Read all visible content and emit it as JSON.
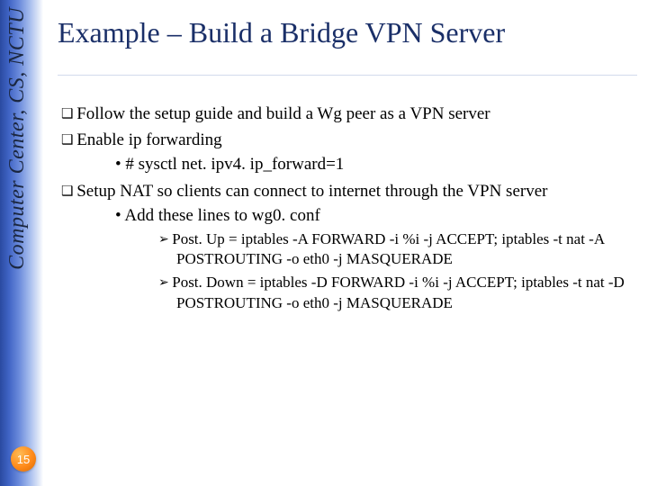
{
  "sidebar": {
    "org_text": "Computer Center, CS, NCTU"
  },
  "page_number": "15",
  "title": "Example – Build a Bridge VPN Server",
  "bullets": {
    "b1": "Follow the setup guide and build a Wg peer as a VPN server",
    "b2": "Enable ip forwarding",
    "b2_1": "# sysctl net. ipv4. ip_forward=1",
    "b3": "Setup NAT so clients can connect to internet through the VPN server",
    "b3_1": "Add these lines to wg0. conf",
    "b3_1_a": "Post. Up = iptables -A FORWARD -i %i -j ACCEPT; iptables -t nat -A POSTROUTING -o eth0 -j MASQUERADE",
    "b3_1_b": "Post. Down = iptables -D FORWARD -i %i -j ACCEPT; iptables -t nat -D POSTROUTING -o eth0 -j MASQUERADE"
  }
}
